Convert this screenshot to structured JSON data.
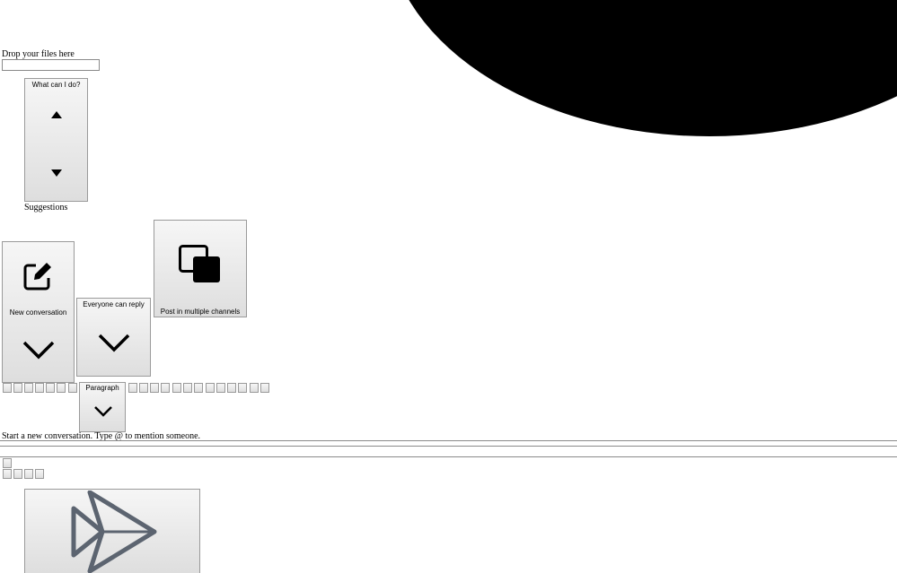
{
  "upload": {
    "drop_label": "Drop your files here"
  },
  "suggestions": {
    "header": "What can I do?",
    "caption": "Suggestions"
  },
  "compose_toolbar": {
    "new_conversation_label": "New conversation",
    "reply_setting_label": "Everyone can reply",
    "post_multiple_label": "Post in multiple channels"
  },
  "format_toolbar": {
    "paragraph_label": "Paragraph"
  },
  "editor": {
    "placeholder": "Start a new conversation. Type @ to mention someone."
  },
  "footer": {
    "send_icon": "send-icon"
  },
  "colors": {
    "blob": "#000000",
    "button_top": "#f6f6f6",
    "button_bottom": "#dedede",
    "border": "#9a9a9a",
    "send_icon_stroke": "#5c6470"
  }
}
